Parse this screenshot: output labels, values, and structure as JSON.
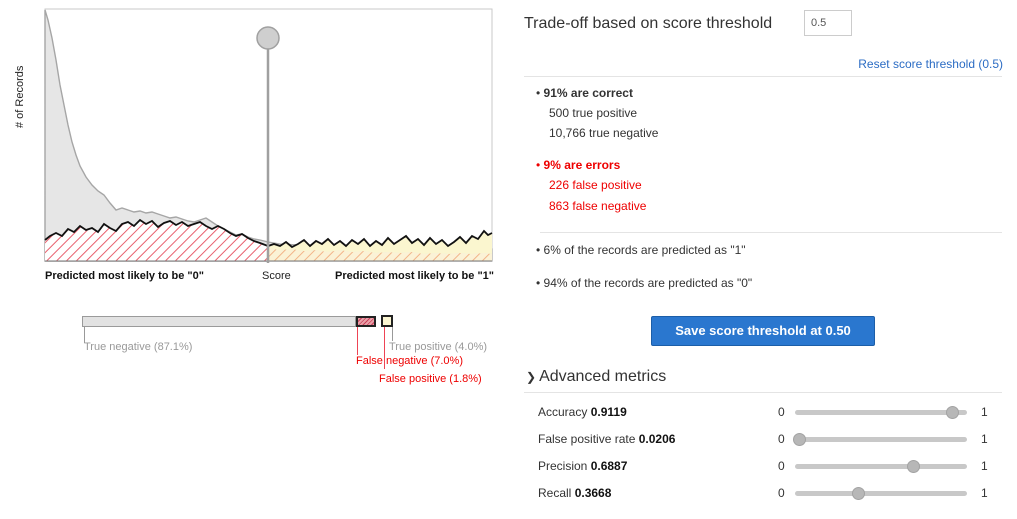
{
  "chart": {
    "ylabel": "# of Records",
    "left_label": "Predicted most likely to be \"0\"",
    "center_label": "Score",
    "right_label": "Predicted most likely to be \"1\"",
    "threshold": 0.5
  },
  "distribution_legend": {
    "true_negative": "True negative (87.1%)",
    "false_negative": "False negative (7.0%)",
    "false_positive": "False positive (1.8%)",
    "true_positive": "True positive (4.0%)"
  },
  "header": {
    "title": "Trade-off based on score threshold",
    "threshold_value": "0.5",
    "reset_link": "Reset score threshold (0.5)"
  },
  "summary": {
    "correct_title": "91% are correct",
    "true_positive": "500 true positive",
    "true_negative": "10,766 true negative",
    "errors_title": "9% are errors",
    "false_positive": "226 false positive",
    "false_negative": "863 false negative",
    "predicted_1": "6% of the records are predicted as \"1\"",
    "predicted_0": "94% of the records are predicted as \"0\""
  },
  "save_button": "Save score threshold at 0.50",
  "advanced": {
    "title": "Advanced metrics",
    "min_label": "0",
    "max_label": "1",
    "metrics": [
      {
        "name": "Accuracy",
        "value": "0.9119",
        "level": 0.9119
      },
      {
        "name": "False positive rate",
        "value": "0.0206",
        "level": 0.0206
      },
      {
        "name": "Precision",
        "value": "0.6887",
        "level": 0.6887
      },
      {
        "name": "Recall",
        "value": "0.3668",
        "level": 0.3668
      }
    ]
  },
  "colors": {
    "accent": "#2a77cf",
    "error": "#ee0000",
    "link": "#2b6cc4"
  }
}
